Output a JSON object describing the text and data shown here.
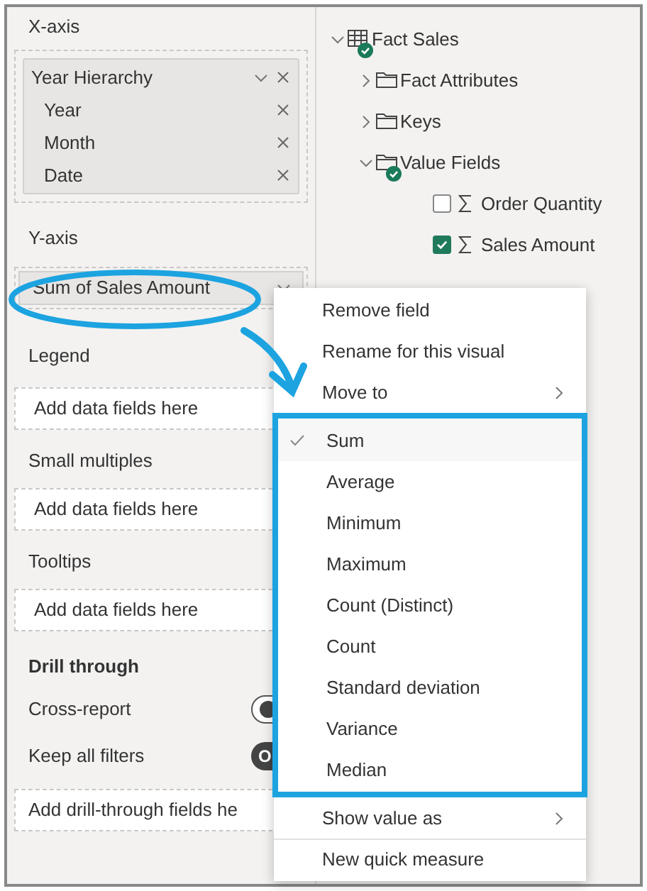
{
  "field_wells": {
    "x_axis": {
      "label": "X-axis",
      "hierarchy": {
        "name": "Year Hierarchy",
        "levels": [
          "Year",
          "Month",
          "Date"
        ]
      }
    },
    "y_axis": {
      "label": "Y-axis",
      "field": "Sum of Sales Amount"
    },
    "empty_wells": [
      {
        "label": "Legend",
        "placeholder": "Add data fields here"
      },
      {
        "label": "Small multiples",
        "placeholder": "Add data fields here"
      },
      {
        "label": "Tooltips",
        "placeholder": "Add data fields here"
      }
    ],
    "drill_through": {
      "label": "Drill through",
      "toggles": [
        {
          "label": "Cross-report",
          "on": false
        },
        {
          "label": "Keep all filters",
          "on": true,
          "toggle_text": "O"
        }
      ],
      "placeholder": "Add drill-through fields he"
    }
  },
  "fields_tree": [
    {
      "kind": "table",
      "label": "Fact Sales",
      "expanded": true,
      "in_use": true,
      "children": [
        {
          "kind": "folder",
          "label": "Fact Attributes",
          "expanded": false,
          "in_use": false
        },
        {
          "kind": "folder",
          "label": "Keys",
          "expanded": false,
          "in_use": false
        },
        {
          "kind": "folder",
          "label": "Value Fields",
          "expanded": true,
          "in_use": true,
          "children": [
            {
              "kind": "field",
              "label": "Order Quantity",
              "checked": false
            },
            {
              "kind": "field",
              "label": "Sales Amount",
              "checked": true
            }
          ]
        }
      ]
    }
  ],
  "context_menu": [
    {
      "kind": "action",
      "label": "Remove field"
    },
    {
      "kind": "action",
      "label": "Rename for this visual"
    },
    {
      "kind": "submenu",
      "label": "Move to"
    },
    {
      "kind": "aggregation",
      "label": "Sum",
      "selected": true
    },
    {
      "kind": "aggregation",
      "label": "Average",
      "selected": false
    },
    {
      "kind": "aggregation",
      "label": "Minimum",
      "selected": false
    },
    {
      "kind": "aggregation",
      "label": "Maximum",
      "selected": false
    },
    {
      "kind": "aggregation",
      "label": "Count (Distinct)",
      "selected": false
    },
    {
      "kind": "aggregation",
      "label": "Count",
      "selected": false
    },
    {
      "kind": "aggregation",
      "label": "Standard deviation",
      "selected": false
    },
    {
      "kind": "aggregation",
      "label": "Variance",
      "selected": false
    },
    {
      "kind": "aggregation",
      "label": "Median",
      "selected": false
    },
    {
      "kind": "submenu",
      "label": "Show value as"
    },
    {
      "kind": "divider_action",
      "label": "New quick measure"
    }
  ]
}
